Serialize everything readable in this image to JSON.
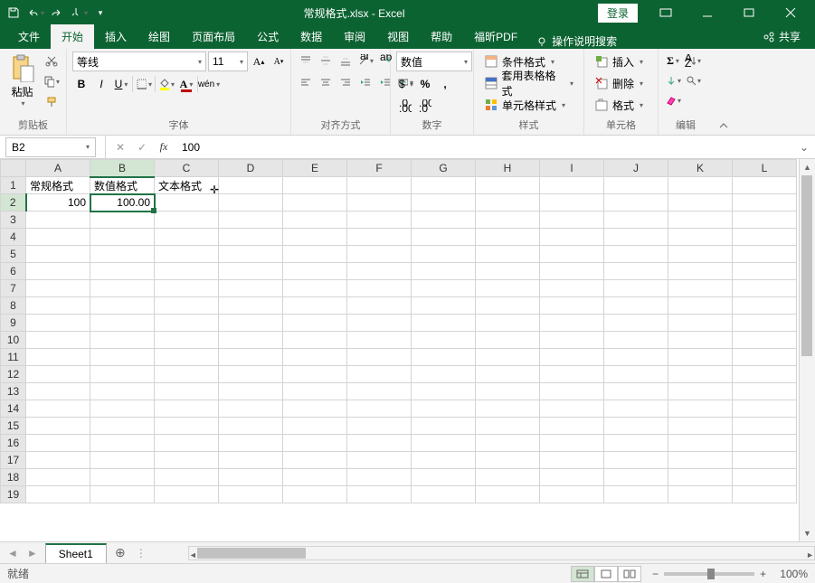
{
  "title_file": "常规格式.xlsx",
  "title_app": "Excel",
  "login": "登录",
  "tabs": {
    "file": "文件",
    "home": "开始",
    "insert": "插入",
    "draw": "绘图",
    "layout": "页面布局",
    "formula": "公式",
    "data": "数据",
    "review": "审阅",
    "view": "视图",
    "help": "帮助",
    "foxit": "福昕PDF",
    "tellme": "操作说明搜索",
    "share": "共享"
  },
  "ribbon": {
    "clipboard": {
      "paste": "粘贴",
      "label": "剪贴板"
    },
    "font": {
      "name": "等线",
      "size": "11",
      "label": "字体"
    },
    "align": {
      "label": "对齐方式"
    },
    "number": {
      "format": "数值",
      "label": "数字"
    },
    "styles": {
      "cond": "条件格式",
      "table": "套用表格格式",
      "cell": "单元格样式",
      "label": "样式"
    },
    "cells": {
      "insert": "插入",
      "delete": "删除",
      "format": "格式",
      "label": "单元格"
    },
    "editing": {
      "label": "编辑"
    }
  },
  "namebox": "B2",
  "formula_value": "100",
  "columns": [
    "A",
    "B",
    "C",
    "D",
    "E",
    "F",
    "G",
    "H",
    "I",
    "J",
    "K",
    "L"
  ],
  "rows": [
    "1",
    "2",
    "3",
    "4",
    "5",
    "6",
    "7",
    "8",
    "9",
    "10",
    "11",
    "12",
    "13",
    "14",
    "15",
    "16",
    "17",
    "18",
    "19"
  ],
  "cells": {
    "A1": "常规格式",
    "B1": "数值格式",
    "C1": "文本格式",
    "A2": "100",
    "B2": "100.00"
  },
  "sheet_tab": "Sheet1",
  "status_ready": "就绪",
  "zoom": "100%"
}
